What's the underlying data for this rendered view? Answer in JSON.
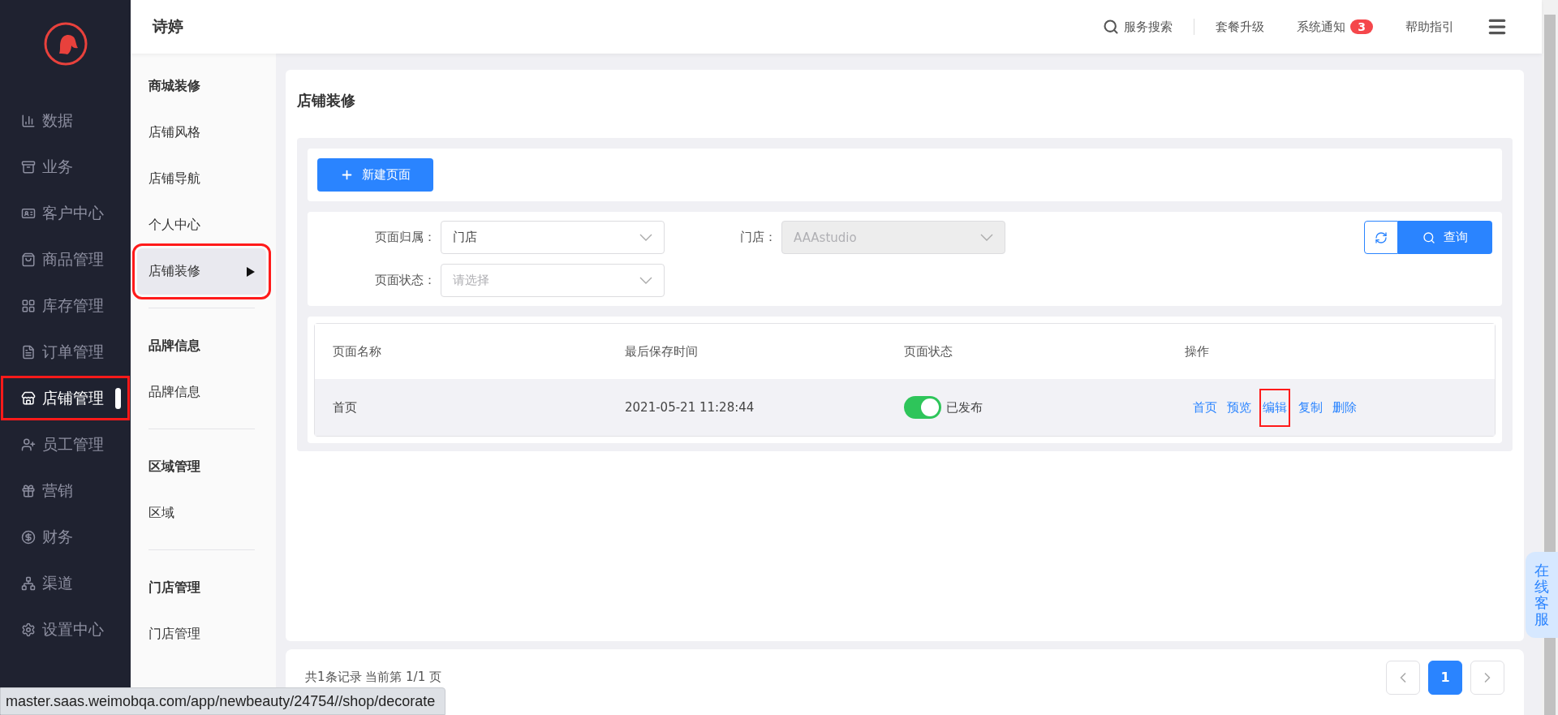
{
  "nav": [
    {
      "label": "数据",
      "selected": false,
      "outlined": false
    },
    {
      "label": "业务",
      "selected": false,
      "outlined": false
    },
    {
      "label": "客户中心",
      "selected": false,
      "outlined": false
    },
    {
      "label": "商品管理",
      "selected": false,
      "outlined": false
    },
    {
      "label": "库存管理",
      "selected": false,
      "outlined": false
    },
    {
      "label": "订单管理",
      "selected": false,
      "outlined": false
    },
    {
      "label": "店铺管理",
      "selected": true,
      "outlined": true
    },
    {
      "label": "员工管理",
      "selected": false,
      "outlined": false
    },
    {
      "label": "营销",
      "selected": false,
      "outlined": false
    },
    {
      "label": "财务",
      "selected": false,
      "outlined": false
    },
    {
      "label": "渠道",
      "selected": false,
      "outlined": false
    },
    {
      "label": "设置中心",
      "selected": false,
      "outlined": false
    }
  ],
  "header": {
    "title": "诗婷",
    "search": "服务搜索",
    "links": [
      {
        "label": "套餐升级"
      },
      {
        "label": "系统通知",
        "badge": "3"
      },
      {
        "label": "帮助指引"
      }
    ]
  },
  "subnav": [
    {
      "title": "商城装修",
      "items": [
        {
          "label": "店铺风格",
          "selected": false,
          "outlined": false
        },
        {
          "label": "店铺导航",
          "selected": false,
          "outlined": false
        },
        {
          "label": "个人中心",
          "selected": false,
          "outlined": false
        },
        {
          "label": "店铺装修",
          "selected": true,
          "outlined": true
        }
      ]
    },
    {
      "title": "品牌信息",
      "items": [
        {
          "label": "品牌信息",
          "selected": false,
          "outlined": false
        }
      ]
    },
    {
      "title": "区域管理",
      "items": [
        {
          "label": "区域",
          "selected": false,
          "outlined": false
        }
      ]
    },
    {
      "title": "门店管理",
      "items": [
        {
          "label": "门店管理",
          "selected": false,
          "outlined": false
        }
      ]
    }
  ],
  "page_title": "店铺装修",
  "new_button": "新建页面",
  "filters": [
    {
      "label": "页面归属：",
      "value": "门店",
      "disabled": false
    },
    {
      "label": "门店：",
      "value": "AAAstudio",
      "disabled": true
    },
    {
      "label": "页面状态：",
      "placeholder": "请选择",
      "disabled": false
    }
  ],
  "query_button": "查询",
  "table": {
    "columns": [
      "页面名称",
      "最后保存时间",
      "页面状态",
      "操作"
    ],
    "rows": [
      {
        "name": "首页",
        "saved": "2021-05-21 11:28:44",
        "status": {
          "on": true,
          "label": "已发布"
        },
        "actions": [
          {
            "label": "首页",
            "outlined": false
          },
          {
            "label": "预览",
            "outlined": false
          },
          {
            "label": "编辑",
            "outlined": true
          },
          {
            "label": "复制",
            "outlined": false
          },
          {
            "label": "删除",
            "outlined": false
          }
        ]
      }
    ]
  },
  "footer": {
    "summary": "共1条记录 当前第 1/1 页",
    "pages": [
      {
        "label": "1",
        "selected": true
      }
    ]
  },
  "service_tab": "在线客服",
  "status_bar": "master.saas.weimobqa.com/app/newbeauty/24754//shop/decorate"
}
